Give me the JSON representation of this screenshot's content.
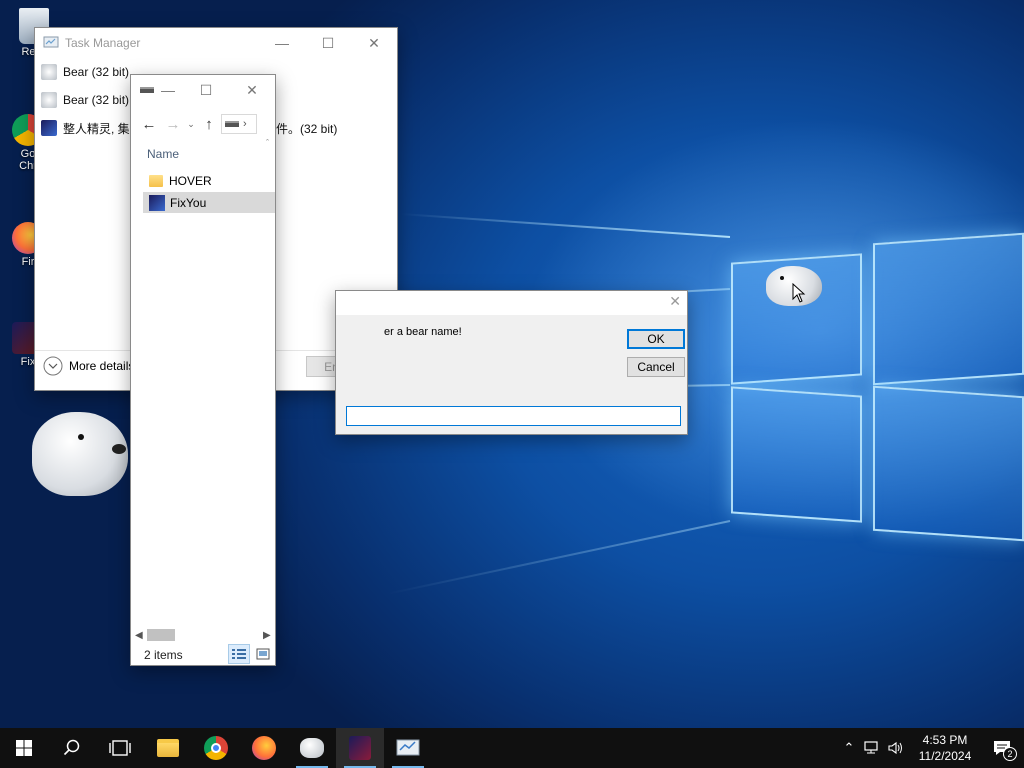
{
  "desktop": {
    "icons": [
      {
        "label": "Recy",
        "icon": "recycle-bin-icon"
      },
      {
        "label": "Go",
        "label2": "Chr",
        "icon": "chrome-icon"
      },
      {
        "label": "Fir",
        "icon": "firefox-icon"
      },
      {
        "label": "Fix",
        "icon": "fixyou-icon"
      }
    ]
  },
  "task_manager": {
    "title": "Task Manager",
    "rows": [
      {
        "name": "Bear (32 bit)",
        "icon": "bear-app-icon"
      },
      {
        "name": "Bear (32 bit)",
        "icon": "bear-app-icon"
      },
      {
        "name_prefix": "整人精灵, 集",
        "name_suffix": "件。(32 bit)",
        "icon": "prank-app-icon"
      }
    ],
    "more_details": "More details",
    "end_task": "End task"
  },
  "explorer": {
    "column_header": "Name",
    "items": [
      {
        "name": "HOVER",
        "icon": "folder-icon"
      },
      {
        "name": "FixYou",
        "icon": "fixyou-file-icon",
        "selected": true
      }
    ],
    "status": "2 items"
  },
  "dialog": {
    "prompt": "er a bear name!",
    "ok": "OK",
    "cancel": "Cancel",
    "input_value": ""
  },
  "taskbar": {
    "items": [
      "start-icon",
      "search-icon",
      "task-view-icon",
      "file-explorer-icon",
      "chrome-icon",
      "firefox-icon",
      "bear-app-icon",
      "fixyou-icon",
      "task-manager-icon"
    ],
    "active_item": "fixyou-icon",
    "time": "4:53 PM",
    "date": "11/2/2024",
    "notification_count": "2"
  },
  "colors": {
    "accent": "#0078d7",
    "taskbar": "#101010",
    "selection": "#d9d9d9"
  }
}
